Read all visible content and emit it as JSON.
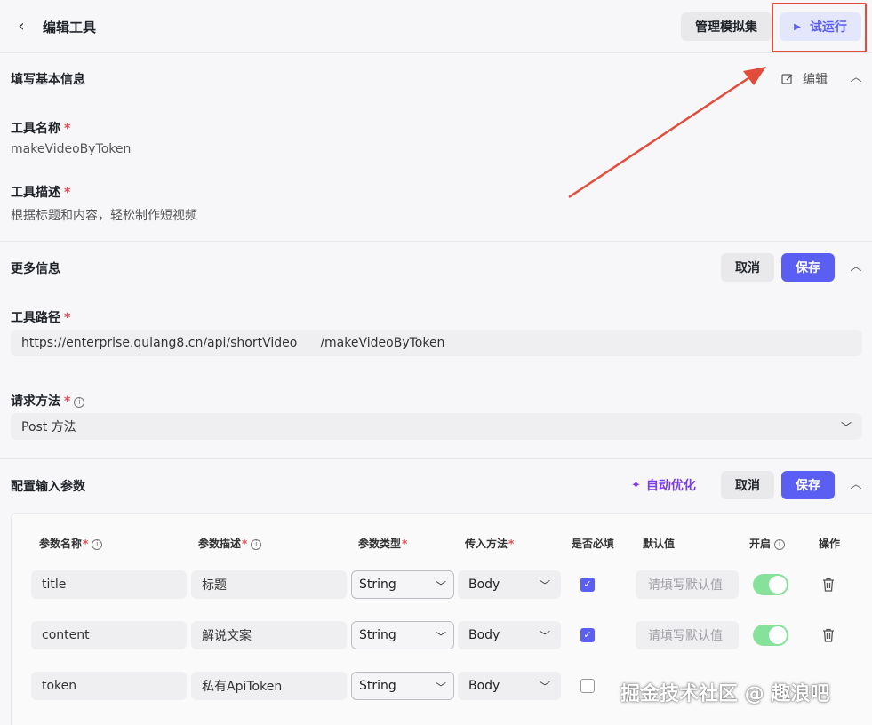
{
  "header": {
    "title": "编辑工具",
    "manage_button": "管理模拟集",
    "run_button": "试运行"
  },
  "basic_info": {
    "section_title": "填写基本信息",
    "edit_label": "编辑",
    "tool_name_label": "工具名称",
    "tool_name_value": "makeVideoByToken",
    "tool_desc_label": "工具描述",
    "tool_desc_value": "根据标题和内容，轻松制作短视频"
  },
  "more_info": {
    "section_title": "更多信息",
    "cancel_label": "取消",
    "save_label": "保存",
    "path_label": "工具路径",
    "path_base": "https://enterprise.qulang8.cn/api/shortVideo",
    "path_suffix": "/makeVideoByToken",
    "method_label": "请求方法",
    "method_value": "Post 方法"
  },
  "input_params": {
    "section_title": "配置输入参数",
    "auto_optimize_label": "自动优化",
    "cancel_label": "取消",
    "save_label": "保存",
    "columns": [
      "参数名称",
      "参数描述",
      "参数类型",
      "传入方法",
      "是否必填",
      "默认值",
      "开启",
      "操作"
    ],
    "rows": [
      {
        "name": "title",
        "desc": "标题",
        "type": "String",
        "method": "Body",
        "required": true,
        "default_placeholder": "请填写默认值",
        "enabled": true
      },
      {
        "name": "content",
        "desc": "解说文案",
        "type": "String",
        "method": "Body",
        "required": true,
        "default_placeholder": "请填写默认值",
        "enabled": true
      },
      {
        "name": "token",
        "desc": "私有ApiToken",
        "type": "String",
        "method": "Body",
        "required": false
      }
    ]
  },
  "watermark": {
    "text": "掘金技术社区 @ 趣浪吧"
  },
  "colors": {
    "primary": "#5b5ef2",
    "required_star": "#e5484d",
    "toggle_on": "#86e19a",
    "annotation_red": "#e24d3b",
    "auto_optimize": "#7c3aed"
  }
}
